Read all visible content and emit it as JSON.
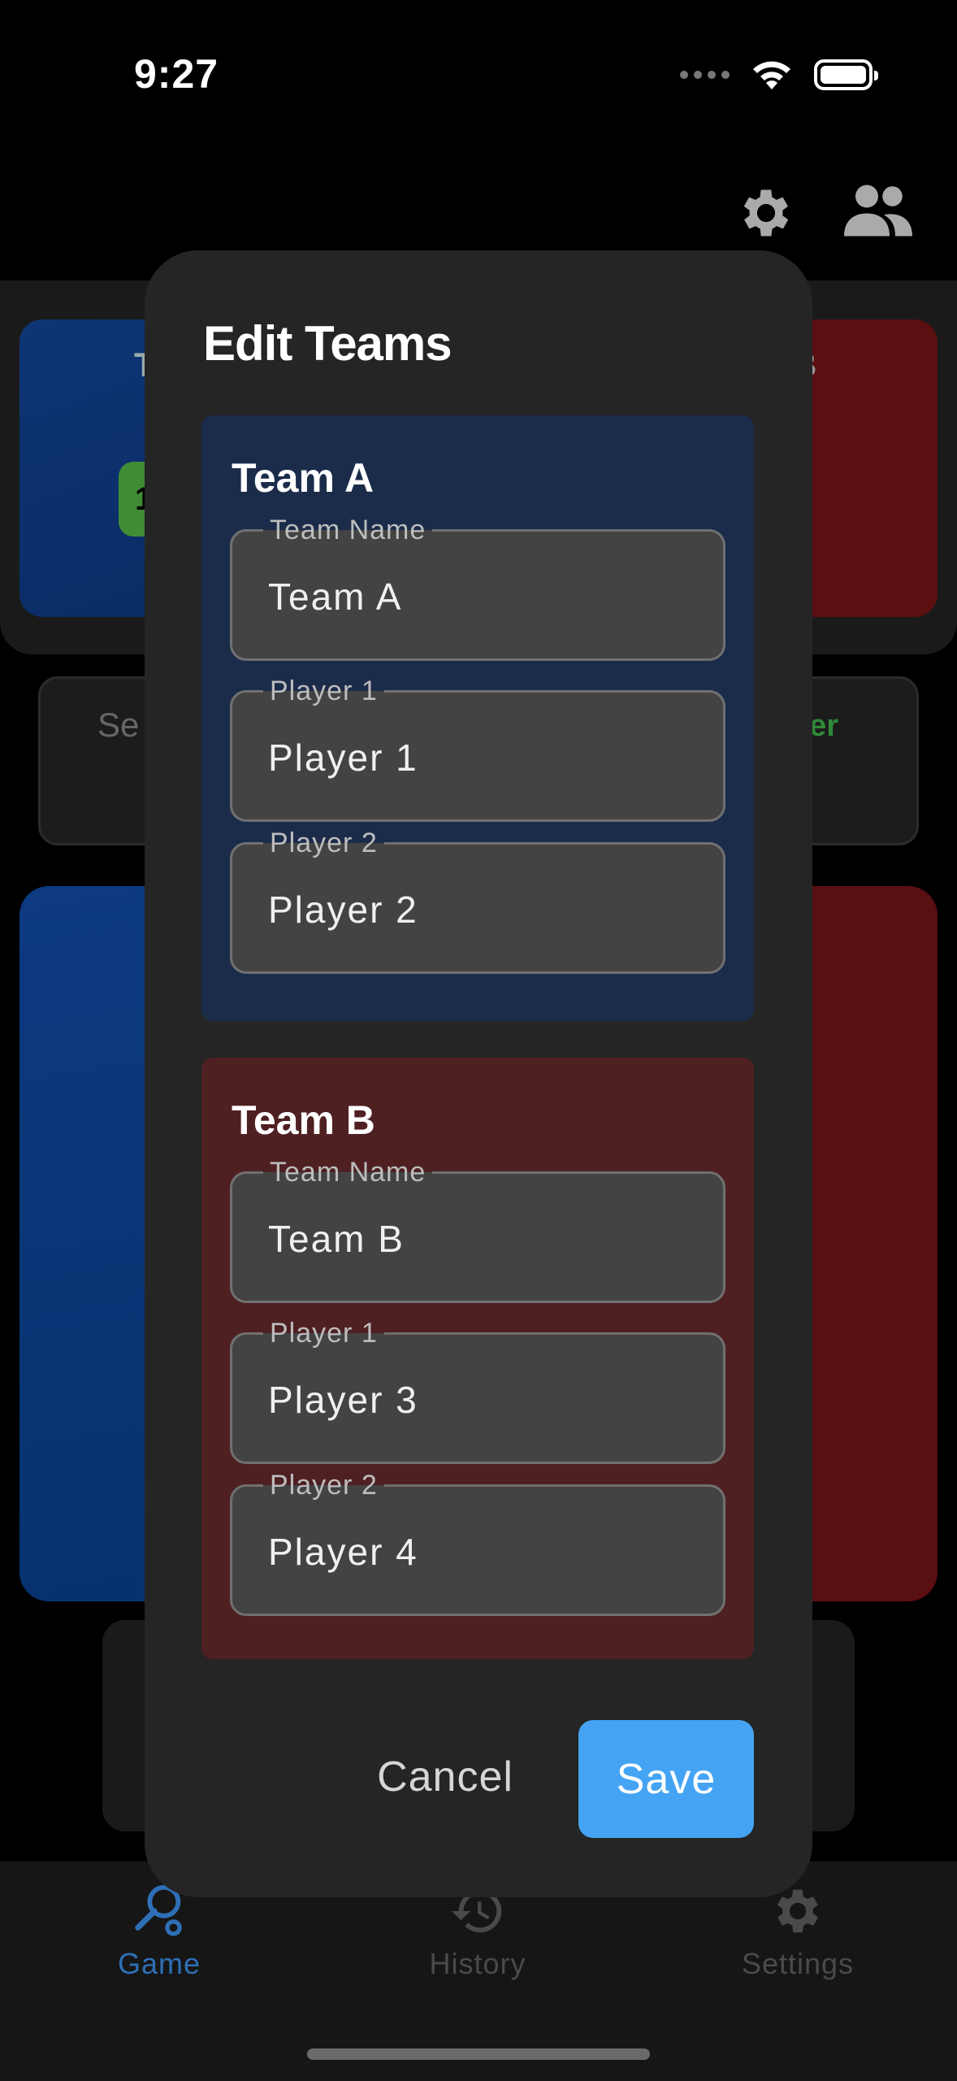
{
  "status_bar": {
    "time": "9:27",
    "icons": [
      "cellular-dots-icon",
      "wifi-icon",
      "battery-icon"
    ]
  },
  "header": {
    "icons": [
      "gear-icon",
      "people-icon"
    ]
  },
  "background": {
    "team_a_initial": "T",
    "team_b_initial": "B",
    "score_badge": "1",
    "mid_left_text": "Se",
    "mid_right_text": "ver"
  },
  "dialog": {
    "title": "Edit Teams",
    "team_a": {
      "heading": "Team A",
      "team_name_label": "Team Name",
      "team_name_value": "Team A",
      "player1_label": "Player 1",
      "player1_value": "Player 1",
      "player2_label": "Player 2",
      "player2_value": "Player 2",
      "color": "#1b2c4b"
    },
    "team_b": {
      "heading": "Team B",
      "team_name_label": "Team Name",
      "team_name_value": "Team B",
      "player1_label": "Player 1",
      "player1_value": "Player 3",
      "player2_label": "Player 2",
      "player2_value": "Player 4",
      "color": "#4f2022"
    },
    "cancel_label": "Cancel",
    "save_label": "Save",
    "save_color": "#44a4f3"
  },
  "bottom_nav": {
    "items": [
      {
        "label": "Game",
        "icon": "racket-icon",
        "active": true
      },
      {
        "label": "History",
        "icon": "history-icon",
        "active": false
      },
      {
        "label": "Settings",
        "icon": "gear-icon",
        "active": false
      }
    ],
    "active_color": "#2e6fb6"
  }
}
